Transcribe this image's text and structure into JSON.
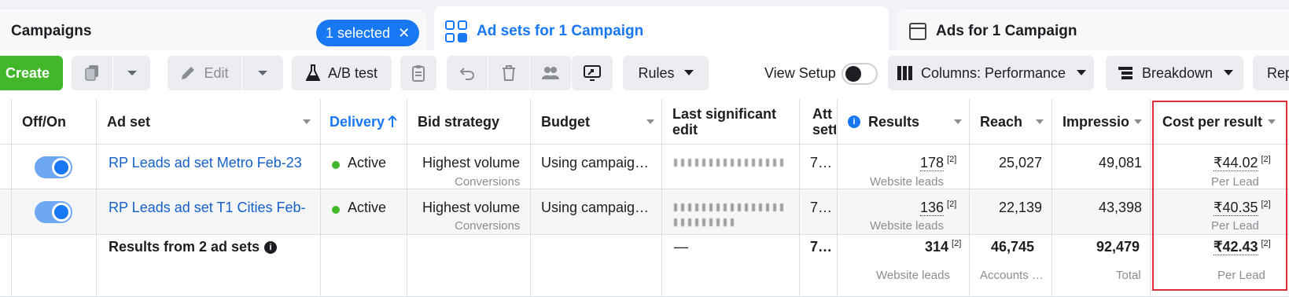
{
  "tabs": {
    "campaigns": "Campaigns",
    "selected_pill": "1 selected",
    "adsets": "Ad sets for 1 Campaign",
    "ads": "Ads for 1 Campaign"
  },
  "toolbar": {
    "create": "Create",
    "edit": "Edit",
    "ab_test": "A/B test",
    "rules": "Rules",
    "view_setup": "View Setup",
    "columns": "Columns: Performance",
    "breakdown": "Breakdown",
    "reports_partial": "Rep"
  },
  "table": {
    "headers": {
      "off_on": "Off/On",
      "ad_set": "Ad set",
      "delivery": "Delivery",
      "bid_strategy": "Bid strategy",
      "budget": "Budget",
      "last_edit_1": "Last significant",
      "last_edit_2": "edit",
      "attribution_1": "Att",
      "attribution_2": "sett",
      "results": "Results",
      "reach": "Reach",
      "impressions": "Impressio",
      "cost_per_result": "Cost per result"
    },
    "rows": [
      {
        "ad_set": "RP Leads ad set Metro Feb-23",
        "delivery": "Active",
        "bid_strategy": "Highest volume",
        "bid_sub": "Conversions",
        "budget": "Using campaig…",
        "attribution": "7…",
        "results": "178",
        "results_sup": "[2]",
        "results_sub": "Website leads",
        "reach": "25,027",
        "impressions": "49,081",
        "cost": "₹44.02",
        "cost_sup": "[2]",
        "cost_sub": "Per Lead"
      },
      {
        "ad_set": "RP Leads ad set T1 Cities Feb-…",
        "delivery": "Active",
        "bid_strategy": "Highest volume",
        "bid_sub": "Conversions",
        "budget": "Using campaig…",
        "attribution": "7…",
        "results": "136",
        "results_sup": "[2]",
        "results_sub": "Website leads",
        "reach": "22,139",
        "impressions": "43,398",
        "cost": "₹40.35",
        "cost_sup": "[2]",
        "cost_sub": "Per Lead"
      }
    ],
    "summary": {
      "label": "Results from 2 ad sets",
      "last_edit": "—",
      "attribution": "7…",
      "results": "314",
      "results_sup": "[2]",
      "results_sub": "Website leads",
      "reach": "46,745",
      "reach_sub": "Accounts …",
      "impressions": "92,479",
      "impressions_sub": "Total",
      "cost": "₹42.43",
      "cost_sup": "[2]",
      "cost_sub": "Per Lead"
    }
  },
  "colors": {
    "accent": "#1877f2",
    "create": "#42b72a",
    "highlight_box": "#e02d3c"
  }
}
